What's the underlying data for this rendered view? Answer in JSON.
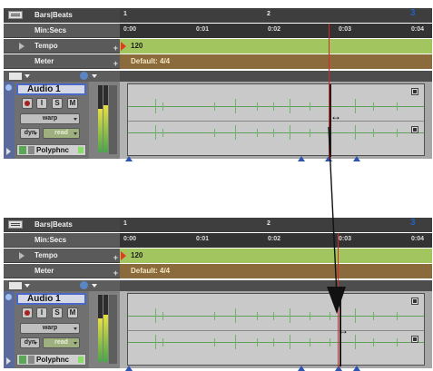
{
  "panels": [
    {
      "ruler": {
        "bars_label": "Bars|Beats",
        "bars_ticks": [
          {
            "label": "1"
          },
          {
            "label": "2"
          },
          {
            "label": "3"
          }
        ],
        "mins_label": "Min:Secs",
        "mins_ticks": [
          "0:00",
          "0:01",
          "0:02",
          "0:03",
          "0:04"
        ],
        "tempo_label": "Tempo",
        "tempo_value": "120",
        "meter_label": "Meter",
        "meter_value": "Default: 4/4"
      },
      "track": {
        "name": "Audio 1",
        "buttons": [
          "I",
          "S",
          "M"
        ],
        "warp_label": "warp",
        "dyn_label": "dyn",
        "read_label": "read",
        "voice_label": "Polyphnc"
      }
    },
    {
      "ruler": {
        "bars_label": "Bars|Beats",
        "bars_ticks": [
          {
            "label": "1"
          },
          {
            "label": "2"
          },
          {
            "label": "3"
          }
        ],
        "mins_label": "Min:Secs",
        "mins_ticks": [
          "0:00",
          "0:01",
          "0:02",
          "0:03",
          "0:04"
        ],
        "tempo_label": "Tempo",
        "tempo_value": "120",
        "meter_label": "Meter",
        "meter_value": "Default: 4/4"
      },
      "track": {
        "name": "Audio 1",
        "buttons": [
          "I",
          "S",
          "M"
        ],
        "warp_label": "warp",
        "dyn_label": "dyn",
        "read_label": "read",
        "voice_label": "Polyphnc"
      }
    }
  ],
  "colors": {
    "tempo_lane": "#a3c55f",
    "meter_lane": "#8b6a3b",
    "waveform": "#6fb26a",
    "warp_marker": "#2d55b0",
    "playhead": "#d42a2a"
  }
}
